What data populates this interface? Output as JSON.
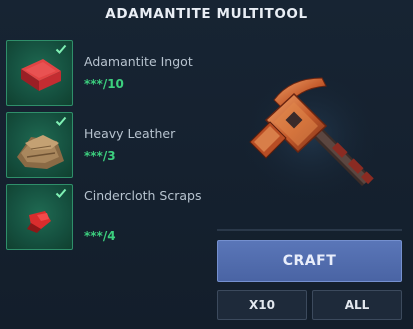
{
  "title": "ADAMANTITE MULTITOOL",
  "ingredients": [
    {
      "name": "Adamantite Ingot",
      "count": "***/10",
      "icon": "ingot-icon",
      "ready": true
    },
    {
      "name": "Heavy Leather",
      "count": "***/3",
      "icon": "leather-icon",
      "ready": true
    },
    {
      "name": "Cindercloth Scraps",
      "count": "***/4",
      "icon": "cloth-icon",
      "ready": true
    }
  ],
  "result": {
    "icon": "multitool-icon"
  },
  "buttons": {
    "craft": "CRAFT",
    "x10": "X10",
    "all": "ALL"
  },
  "colors": {
    "background": "#141f2c",
    "slot_green": "#15503f",
    "count_green": "#3ccf7e",
    "craft_blue": "#4a64a4"
  }
}
